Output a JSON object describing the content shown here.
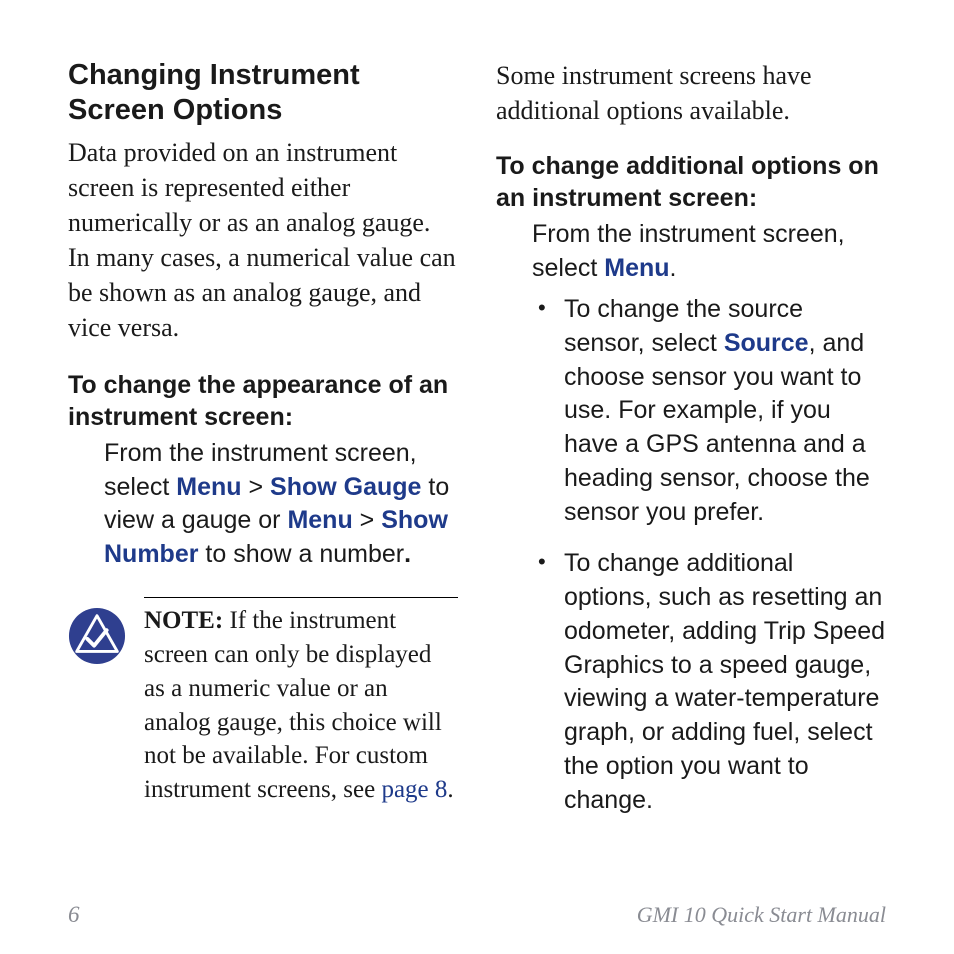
{
  "col1": {
    "heading": "Changing Instrument Screen Options",
    "intro": "Data provided on an instrument screen is represented either numerically or as an analog gauge. In many cases, a numerical value can be shown as an analog gauge, and vice versa.",
    "sub1": "To change the appearance of an instrument screen:",
    "instr1_pre": "From the instrument screen, select ",
    "kw_menu1": "Menu",
    "gt1": " > ",
    "kw_show_gauge": "Show Gauge",
    "instr1_mid": " to view a gauge or ",
    "kw_menu2": "Menu",
    "gt2": " > ",
    "kw_show_number": "Show Number",
    "instr1_post": " to show a number",
    "instr1_end": ".",
    "note_label": "NOTE:",
    "note_body_a": " If the instrument screen can only be displayed as a numeric value or an analog gauge, this choice will not be available. For custom instrument screens, see ",
    "note_link": "page 8",
    "note_body_b": "."
  },
  "col2": {
    "intro": "Some instrument screens have additional options available.",
    "sub1": "To change additional options on an instrument screen:",
    "instr1_pre": "From the instrument screen, select ",
    "kw_menu": "Menu",
    "instr1_post": ".",
    "bullet1_a": "To change the source sensor, select ",
    "bullet1_kw": "Source",
    "bullet1_b": ", and choose sensor you want to use. For example, if you have a GPS antenna and a heading sensor, choose the sensor you prefer.",
    "bullet2": "To change additional options, such as resetting an odometer, adding Trip Speed Graphics to a speed gauge, viewing a water-temperature graph, or adding fuel, select the option you want to change."
  },
  "footer": {
    "page": "6",
    "title": "GMI 10 Quick Start Manual"
  }
}
